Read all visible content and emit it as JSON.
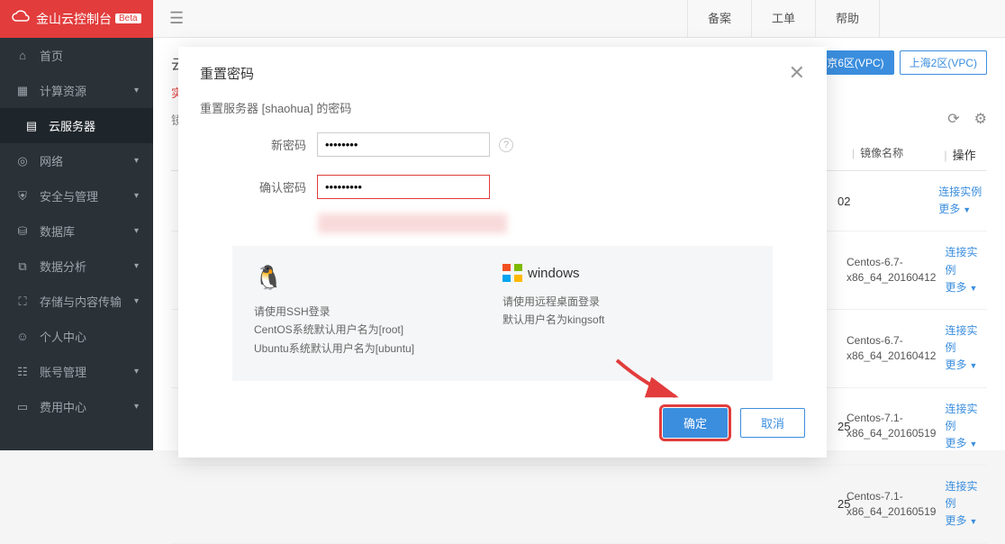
{
  "header": {
    "logo_text": "金山云控制台",
    "beta": "Beta",
    "links": {
      "beian": "备案",
      "order": "工单",
      "help": "帮助"
    }
  },
  "sidebar": {
    "items": [
      {
        "icon": "⌂",
        "label": "首页"
      },
      {
        "icon": "▦",
        "label": "计算资源",
        "chev": true
      },
      {
        "icon": "▤",
        "label": "云服务器",
        "active": true
      },
      {
        "icon": "◎",
        "label": "网络",
        "chev": true
      },
      {
        "icon": "⛨",
        "label": "安全与管理",
        "chev": true
      },
      {
        "icon": "⛁",
        "label": "数据库",
        "chev": true
      },
      {
        "icon": "⧉",
        "label": "数据分析",
        "chev": true
      },
      {
        "icon": "⛶",
        "label": "存储与内容传输",
        "chev": true
      },
      {
        "icon": "☺",
        "label": "个人中心"
      },
      {
        "icon": "☷",
        "label": "账号管理",
        "chev": true
      },
      {
        "icon": "▭",
        "label": "费用中心",
        "chev": true
      }
    ]
  },
  "main": {
    "crumb": "云",
    "tabs": {
      "instances": "实",
      "images": "镜"
    },
    "regions": {
      "bj": "北京6区(VPC)",
      "sh": "上海2区(VPC)"
    },
    "table": {
      "headers": {
        "image_name": "镜像名称",
        "ops": "操作"
      },
      "rows": [
        {
          "date": "02",
          "image": "",
          "ops": {
            "conn": "连接实例",
            "more": "更多"
          }
        },
        {
          "date": "",
          "image": "Centos-6.7-x86_64_20160412",
          "ops": {
            "conn": "连接实例",
            "more": "更多"
          }
        },
        {
          "date": "",
          "image": "Centos-6.7-x86_64_20160412",
          "ops": {
            "conn": "连接实例",
            "more": "更多"
          }
        },
        {
          "date": "25",
          "image": "Centos-7.1-x86_64_20160519",
          "ops": {
            "conn": "连接实例",
            "more": "更多"
          }
        },
        {
          "date": "25",
          "image": "Centos-7.1-x86_64_20160519",
          "ops": {
            "conn": "连接实例",
            "more": "更多"
          }
        }
      ]
    }
  },
  "modal": {
    "title": "重置密码",
    "subtitle": "重置服务器 [shaohua] 的密码",
    "form": {
      "new_pwd_label": "新密码",
      "new_pwd_value": "••••••••",
      "confirm_pwd_label": "确认密码",
      "confirm_pwd_value": "•••••••••"
    },
    "info": {
      "linux": {
        "title": "",
        "line1": "请使用SSH登录",
        "line2": "CentOS系统默认用户名为[root]",
        "line3": "Ubuntu系统默认用户名为[ubuntu]"
      },
      "windows": {
        "title": "windows",
        "line1": "请使用远程桌面登录",
        "line2": "默认用户名为kingsoft"
      }
    },
    "buttons": {
      "ok": "确定",
      "cancel": "取消"
    }
  }
}
